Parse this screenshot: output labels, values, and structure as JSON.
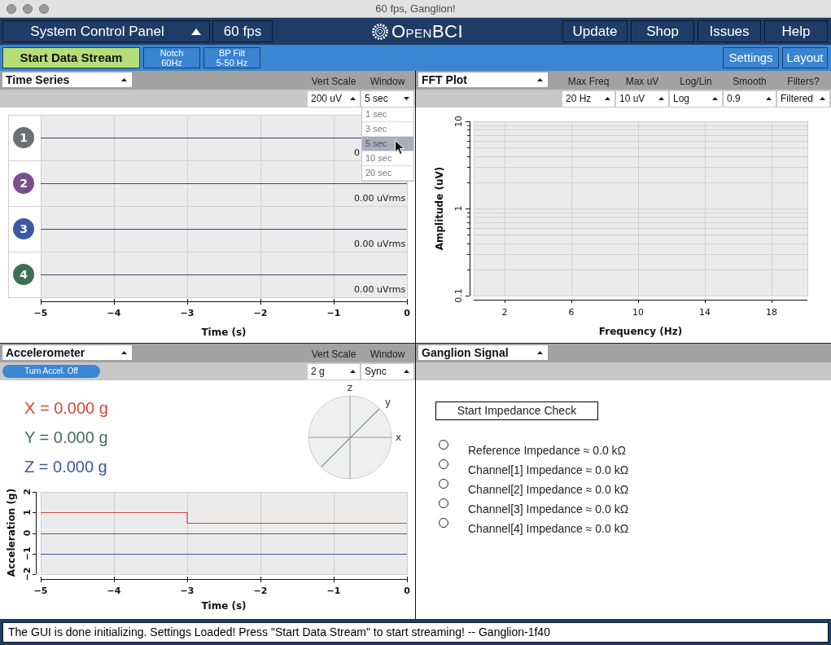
{
  "window": {
    "title": "60 fps, Ganglion!"
  },
  "top_bar": {
    "panel_menu": "System Control Panel",
    "frame_rate": "60 fps",
    "logo": "OpenBCI",
    "links": [
      "Update",
      "Shop",
      "Issues",
      "Help"
    ]
  },
  "toolbar": {
    "start_button": "Start Data Stream",
    "filters": [
      {
        "lines": [
          "Notch",
          "60Hz"
        ]
      },
      {
        "lines": [
          "BP Filt",
          "5-50 Hz"
        ]
      }
    ],
    "right_buttons": [
      "Settings",
      "Layout"
    ]
  },
  "time_series": {
    "widget": "Time Series",
    "controls": [
      {
        "label": "Vert Scale",
        "value": "200 uV",
        "open": false
      },
      {
        "label": "Window",
        "value": "5 sec",
        "open": true,
        "options": [
          {
            "label": "1 sec",
            "selected": false
          },
          {
            "label": "3 sec",
            "selected": false
          },
          {
            "label": "5 sec",
            "selected": true
          },
          {
            "label": "10 sec",
            "selected": false
          },
          {
            "label": "20 sec",
            "selected": false
          }
        ]
      }
    ],
    "channels": [
      {
        "number": "1",
        "color": "#6d6f74",
        "reading": "0"
      },
      {
        "number": "2",
        "color": "#7b4f8c",
        "reading": "0.00 uVrms"
      },
      {
        "number": "3",
        "color": "#3b58a0",
        "reading": "0.00 uVrms"
      },
      {
        "number": "4",
        "color": "#3f6e59",
        "reading": "0.00 uVrms"
      }
    ],
    "x_ticks": [
      "−5",
      "−4",
      "−3",
      "−2",
      "−1",
      "0"
    ],
    "x_label": "Time (s)"
  },
  "fft_plot": {
    "widget": "FFT Plot",
    "controls": [
      {
        "label": "Max Freq",
        "value": "20 Hz",
        "open": false
      },
      {
        "label": "Max uV",
        "value": "10 uV",
        "open": false
      },
      {
        "label": "Log/Lin",
        "value": "Log",
        "open": false
      },
      {
        "label": "Smooth",
        "value": "0.9",
        "open": false
      },
      {
        "label": "Filters?",
        "value": "Filtered",
        "open": false
      }
    ],
    "y_ticks": [
      "10",
      "1",
      "0.1"
    ],
    "x_ticks": [
      "2",
      "6",
      "10",
      "14",
      "18"
    ],
    "x_label": "Frequency (Hz)",
    "y_label": "Amplitude (uV)"
  },
  "accelerometer": {
    "widget": "Accelerometer",
    "toggle": "Turn Accel. Off",
    "controls": [
      {
        "label": "Vert Scale",
        "value": "2 g",
        "open": false
      },
      {
        "label": "Window",
        "value": "Sync",
        "open": false
      }
    ],
    "readouts": [
      {
        "text": "X = 0.000 g",
        "color": "#d4473b"
      },
      {
        "text": "Y = 0.000 g",
        "color": "#3f6e59"
      },
      {
        "text": "Z = 0.000 g",
        "color": "#3b58a0"
      }
    ],
    "orientation_axes": [
      {
        "label": "z",
        "kind": "vertical"
      },
      {
        "label": "y",
        "kind": "diagonal"
      },
      {
        "label": "x",
        "kind": "horizontal"
      }
    ],
    "chart_data": {
      "type": "line",
      "xlabel": "Time (s)",
      "ylabel": "Acceleration (g)",
      "grid": "x",
      "x": [
        -5,
        -3,
        -3,
        0
      ],
      "series": [
        {
          "color": "#c9473d",
          "values": [
            1,
            1,
            0.5,
            0.5
          ]
        },
        {
          "color": "#3f6e59",
          "values": [
            0,
            0,
            0,
            0
          ]
        },
        {
          "color": "#3b58a0",
          "values": [
            -1,
            -1,
            -1,
            -1
          ]
        }
      ],
      "xlim": [
        -5,
        0
      ],
      "ylim": [
        -2,
        2
      ],
      "xticks": [
        {
          "value": -5,
          "label": "−5"
        },
        {
          "value": -4,
          "label": "−4"
        },
        {
          "value": -3,
          "label": "−3"
        },
        {
          "value": -2,
          "label": "−2"
        },
        {
          "value": -1,
          "label": "−1"
        },
        {
          "value": 0,
          "label": "0"
        }
      ],
      "yticks": [
        {
          "value": -2,
          "label": "−2"
        },
        {
          "value": -1,
          "label": "−1"
        },
        {
          "value": 0,
          "label": "0"
        },
        {
          "value": 1,
          "label": "1"
        },
        {
          "value": 2,
          "label": "2"
        }
      ]
    }
  },
  "ganglion_signal": {
    "widget": "Ganglion Signal",
    "button": "Start Impedance Check",
    "impedances": [
      {
        "label": "Reference Impedance ≈ 0.0 kΩ",
        "on": false
      },
      {
        "label": "Channel[1] Impedance ≈ 0.0 kΩ",
        "on": false
      },
      {
        "label": "Channel[2] Impedance ≈ 0.0 kΩ",
        "on": false
      },
      {
        "label": "Channel[3] Impedance ≈ 0.0 kΩ",
        "on": false
      },
      {
        "label": "Channel[4] Impedance ≈ 0.0 kΩ",
        "on": false
      }
    ]
  },
  "status_bar": {
    "message": "The GUI is done initializing. Settings Loaded! Press \"Start Data Stream\" to start streaming! -- Ganglion-1f40"
  }
}
